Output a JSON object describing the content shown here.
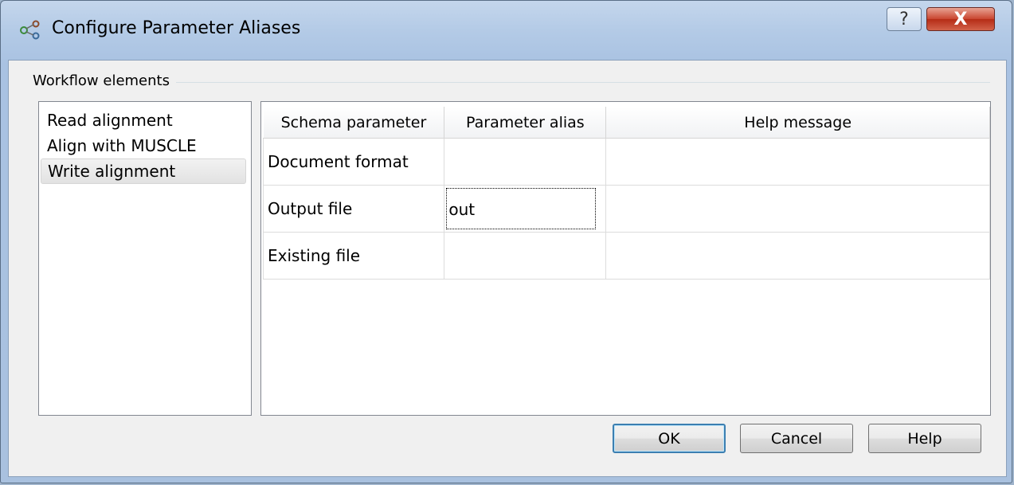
{
  "window": {
    "title": "Configure Parameter Aliases",
    "help_glyph": "?",
    "close_glyph": "X"
  },
  "group": {
    "label": "Workflow elements"
  },
  "elements": [
    {
      "label": "Read alignment",
      "selected": false
    },
    {
      "label": "Align with MUSCLE",
      "selected": false
    },
    {
      "label": "Write alignment",
      "selected": true
    }
  ],
  "table": {
    "headers": [
      "Schema parameter",
      "Parameter alias",
      "Help message"
    ],
    "rows": [
      {
        "parameter": "Document format",
        "alias": "",
        "help": ""
      },
      {
        "parameter": "Output file",
        "alias": "out",
        "help": ""
      },
      {
        "parameter": "Existing file",
        "alias": "",
        "help": ""
      }
    ]
  },
  "buttons": {
    "ok": "OK",
    "cancel": "Cancel",
    "help": "Help"
  },
  "colors": {
    "close_button": "#c9452f",
    "default_button_border": "#3c7fb1"
  }
}
